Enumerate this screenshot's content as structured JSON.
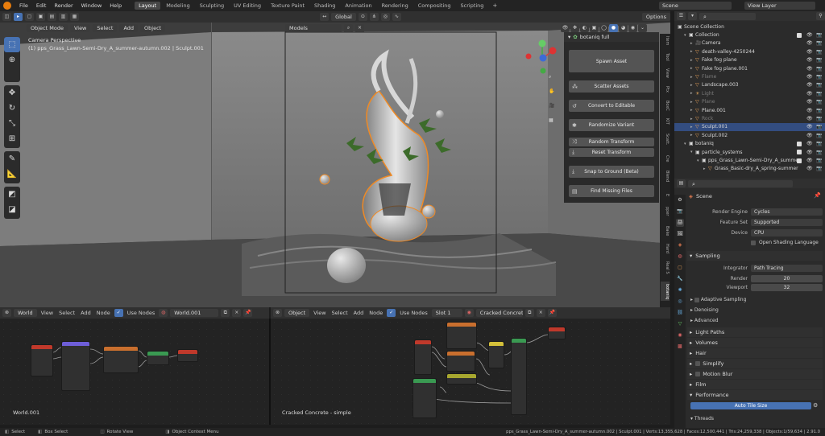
{
  "topbar": {
    "menus": [
      "File",
      "Edit",
      "Render",
      "Window",
      "Help"
    ],
    "workspaces": [
      "Layout",
      "Modeling",
      "Sculpting",
      "UV Editing",
      "Texture Paint",
      "Shading",
      "Animation",
      "Rendering",
      "Compositing",
      "Scripting"
    ],
    "active_workspace": "Layout",
    "scene": "Scene",
    "view_layer": "View Layer"
  },
  "viewport_header": {
    "mode": "Object Mode",
    "menus": [
      "View",
      "Select",
      "Add",
      "Object"
    ],
    "orientation": "Global",
    "options": "Options",
    "collection_filter": "Models"
  },
  "viewport": {
    "camera_label": "Camera Perspective",
    "object_label": "(1) pps_Grass_Lawn-Semi-Dry_A_summer-autumn.002 | Sculpt.001"
  },
  "botaniq": {
    "title": "botaniq full",
    "buttons": [
      "Spawn Asset",
      "Scatter Assets",
      "Convert to Editable",
      "Randomize Variant",
      "Random Transform",
      "Reset Transform",
      "Snap to Ground (Beta)",
      "Find Missing Files"
    ]
  },
  "side_tabs": [
    "Item",
    "Tool",
    "View",
    "Ptx",
    "BoxC",
    "KIT",
    "Scatt.",
    "Cre",
    "Blend",
    "E",
    "pper",
    "Bake",
    "Hard",
    "Real S",
    "botaniq"
  ],
  "outliner": {
    "root": "Scene Collection",
    "rows": [
      {
        "label": "Collection",
        "depth": 1,
        "icon": "collection-icon",
        "state": "normal"
      },
      {
        "label": "Camera",
        "depth": 2,
        "icon": "camera-icon",
        "state": "normal"
      },
      {
        "label": "death-valley-4250244",
        "depth": 2,
        "icon": "mesh-icon",
        "state": "normal"
      },
      {
        "label": "Fake fog plane",
        "depth": 2,
        "icon": "mesh-icon",
        "state": "normal"
      },
      {
        "label": "Fake fog plane.001",
        "depth": 2,
        "icon": "mesh-icon",
        "state": "normal"
      },
      {
        "label": "Flame",
        "depth": 2,
        "icon": "mesh-icon",
        "state": "dim"
      },
      {
        "label": "Landscape.003",
        "depth": 2,
        "icon": "mesh-icon",
        "state": "normal"
      },
      {
        "label": "Light",
        "depth": 2,
        "icon": "light-icon",
        "state": "dim"
      },
      {
        "label": "Plane",
        "depth": 2,
        "icon": "mesh-icon",
        "state": "dim"
      },
      {
        "label": "Plane.001",
        "depth": 2,
        "icon": "mesh-icon",
        "state": "normal"
      },
      {
        "label": "Rock",
        "depth": 2,
        "icon": "mesh-icon",
        "state": "dim"
      },
      {
        "label": "Sculpt.001",
        "depth": 2,
        "icon": "mesh-icon",
        "state": "selected"
      },
      {
        "label": "Sculpt.002",
        "depth": 2,
        "icon": "mesh-icon",
        "state": "normal"
      },
      {
        "label": "botaniq",
        "depth": 1,
        "icon": "collection-icon",
        "state": "normal"
      },
      {
        "label": "particle_systems",
        "depth": 2,
        "icon": "collection-icon",
        "state": "normal"
      },
      {
        "label": "pps_Grass_Lawn-Semi-Dry_A_summer",
        "depth": 3,
        "icon": "collection-icon",
        "state": "normal"
      },
      {
        "label": "Grass_Basic-dry_A_spring-summer",
        "depth": 4,
        "icon": "mesh-icon",
        "state": "normal"
      }
    ]
  },
  "properties": {
    "title": "Scene",
    "render_engine_label": "Render Engine",
    "render_engine": "Cycles",
    "feature_set_label": "Feature Set",
    "feature_set": "Supported",
    "device_label": "Device",
    "device": "CPU",
    "osl_label": "Open Shading Language",
    "sampling": "Sampling",
    "integrator_label": "Integrator",
    "integrator": "Path Tracing",
    "render_label": "Render",
    "render_samples": "20",
    "viewport_label": "Viewport",
    "viewport_samples": "32",
    "adaptive_sampling": "Adaptive Sampling",
    "denoising": "Denoising",
    "advanced": "Advanced",
    "sections": [
      "Light Paths",
      "Volumes",
      "Hair",
      "Simplify",
      "Motion Blur",
      "Film",
      "Performance"
    ],
    "auto_tile_size": "Auto Tile Size",
    "threads": "Threads"
  },
  "node_editor_left": {
    "type": "World",
    "menus": [
      "View",
      "Select",
      "Add",
      "Node"
    ],
    "use_nodes": "Use Nodes",
    "datablock": "World.001",
    "footer": "World.001"
  },
  "node_editor_right": {
    "type": "Object",
    "menus": [
      "View",
      "Select",
      "Add",
      "Node"
    ],
    "use_nodes": "Use Nodes",
    "slot": "Slot 1",
    "material": "Cracked Concrete - ...",
    "footer": "Cracked Concrete - simple"
  },
  "statusbar": {
    "select": "Select",
    "box_select": "Box Select",
    "rotate_view": "Rotate View",
    "context_menu": "Object Context Menu",
    "stats": "pps_Grass_Lawn-Semi-Dry_A_summer-autumn.002 | Sculpt.001 | Verts:13,355,628 | Faces:12,500,441 | Tris:24,259,338 | Objects:1/59,634 | 2.91.0"
  },
  "colors": {
    "accent": "#4772b3",
    "selection_outline": "#f08a24",
    "header": "#303030",
    "background": "#1d1d1d"
  }
}
